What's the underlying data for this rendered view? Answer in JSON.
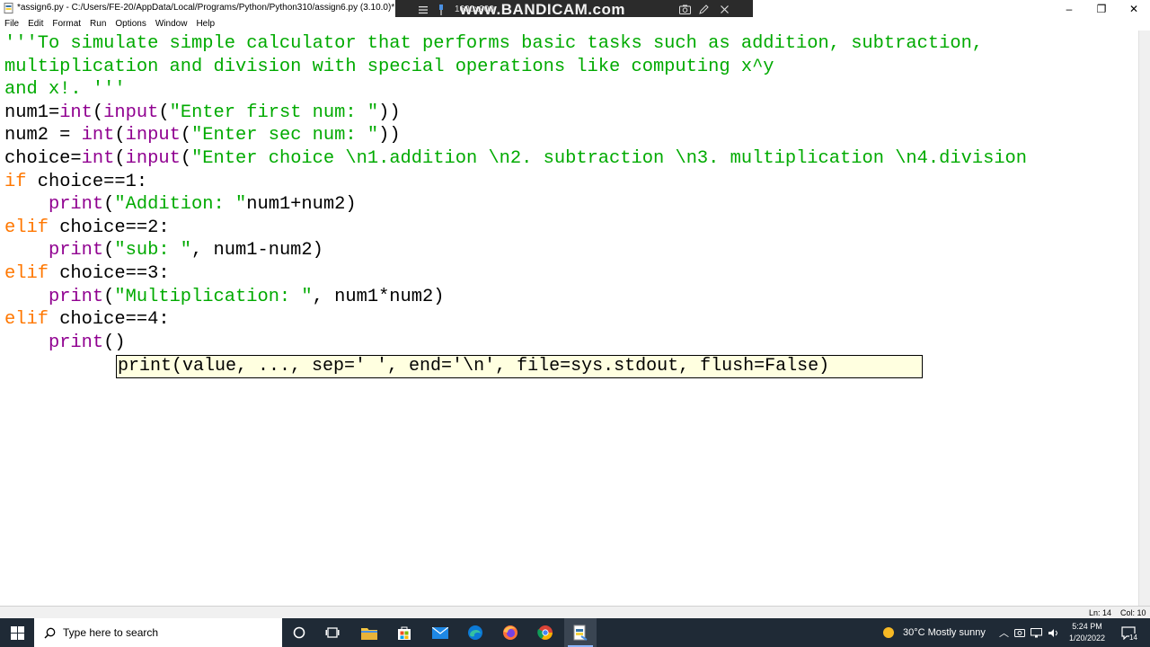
{
  "window": {
    "title": "*assign6.py - C:/Users/FE-20/AppData/Local/Programs/Python/Python310/assign6.py (3.10.0)*",
    "minimize": "–",
    "maximize": "❐",
    "close": "✕"
  },
  "recorder": {
    "resolution": "1600x900",
    "watermark": "www.BANDICAM.com"
  },
  "menu": {
    "items": [
      "File",
      "Edit",
      "Format",
      "Run",
      "Options",
      "Window",
      "Help"
    ]
  },
  "editor": {
    "lines": [
      {
        "segments": [
          {
            "t": "'''To simulate simple calculator that performs basic tasks such as addition, subtraction,",
            "c": "str"
          }
        ]
      },
      {
        "segments": [
          {
            "t": "multiplication and division with special operations like computing x^y",
            "c": "str"
          }
        ]
      },
      {
        "segments": [
          {
            "t": "and x!. '''",
            "c": "str"
          }
        ]
      },
      {
        "segments": [
          {
            "t": "num1=",
            "c": "def"
          },
          {
            "t": "int",
            "c": "bi"
          },
          {
            "t": "(",
            "c": "def"
          },
          {
            "t": "input",
            "c": "bi"
          },
          {
            "t": "(",
            "c": "def"
          },
          {
            "t": "\"Enter first num: \"",
            "c": "str"
          },
          {
            "t": "))",
            "c": "def"
          }
        ]
      },
      {
        "segments": [
          {
            "t": "num2 = ",
            "c": "def"
          },
          {
            "t": "int",
            "c": "bi"
          },
          {
            "t": "(",
            "c": "def"
          },
          {
            "t": "input",
            "c": "bi"
          },
          {
            "t": "(",
            "c": "def"
          },
          {
            "t": "\"Enter sec num: \"",
            "c": "str"
          },
          {
            "t": "))",
            "c": "def"
          }
        ]
      },
      {
        "segments": [
          {
            "t": "choice=",
            "c": "def"
          },
          {
            "t": "int",
            "c": "bi"
          },
          {
            "t": "(",
            "c": "def"
          },
          {
            "t": "input",
            "c": "bi"
          },
          {
            "t": "(",
            "c": "def"
          },
          {
            "t": "\"Enter choice \\n1.addition \\n2. subtraction \\n3. multiplication \\n4.division",
            "c": "str"
          }
        ]
      },
      {
        "segments": [
          {
            "t": "if",
            "c": "kw"
          },
          {
            "t": " choice==1:",
            "c": "def"
          }
        ]
      },
      {
        "segments": [
          {
            "t": "    ",
            "c": "def"
          },
          {
            "t": "print",
            "c": "bi"
          },
          {
            "t": "(",
            "c": "def"
          },
          {
            "t": "\"Addition: \"",
            "c": "str"
          },
          {
            "t": "num1+num2)",
            "c": "def"
          }
        ]
      },
      {
        "segments": [
          {
            "t": "elif",
            "c": "kw"
          },
          {
            "t": " choice==2:",
            "c": "def"
          }
        ]
      },
      {
        "segments": [
          {
            "t": "    ",
            "c": "def"
          },
          {
            "t": "print",
            "c": "bi"
          },
          {
            "t": "(",
            "c": "def"
          },
          {
            "t": "\"sub: \"",
            "c": "str"
          },
          {
            "t": ", num1-num2)",
            "c": "def"
          }
        ]
      },
      {
        "segments": [
          {
            "t": "elif",
            "c": "kw"
          },
          {
            "t": " choice==3:",
            "c": "def"
          }
        ]
      },
      {
        "segments": [
          {
            "t": "    ",
            "c": "def"
          },
          {
            "t": "print",
            "c": "bi"
          },
          {
            "t": "(",
            "c": "def"
          },
          {
            "t": "\"Multiplication: \"",
            "c": "str"
          },
          {
            "t": ", num1*num2)",
            "c": "def"
          }
        ]
      },
      {
        "segments": [
          {
            "t": "elif",
            "c": "kw"
          },
          {
            "t": " choice==4:",
            "c": "def"
          }
        ]
      },
      {
        "segments": [
          {
            "t": "    ",
            "c": "def"
          },
          {
            "t": "print",
            "c": "bi"
          },
          {
            "t": "()",
            "c": "def"
          }
        ]
      }
    ],
    "calltip": "print(value, ..., sep=' ', end='\\n', file=sys.stdout, flush=False)"
  },
  "status": {
    "line": "Ln: 14",
    "col": "Col: 10"
  },
  "taskbar": {
    "search_placeholder": "Type here to search",
    "weather": "30°C  Mostly sunny",
    "time": "5:24 PM",
    "date": "1/20/2022",
    "notification_count": "14"
  }
}
